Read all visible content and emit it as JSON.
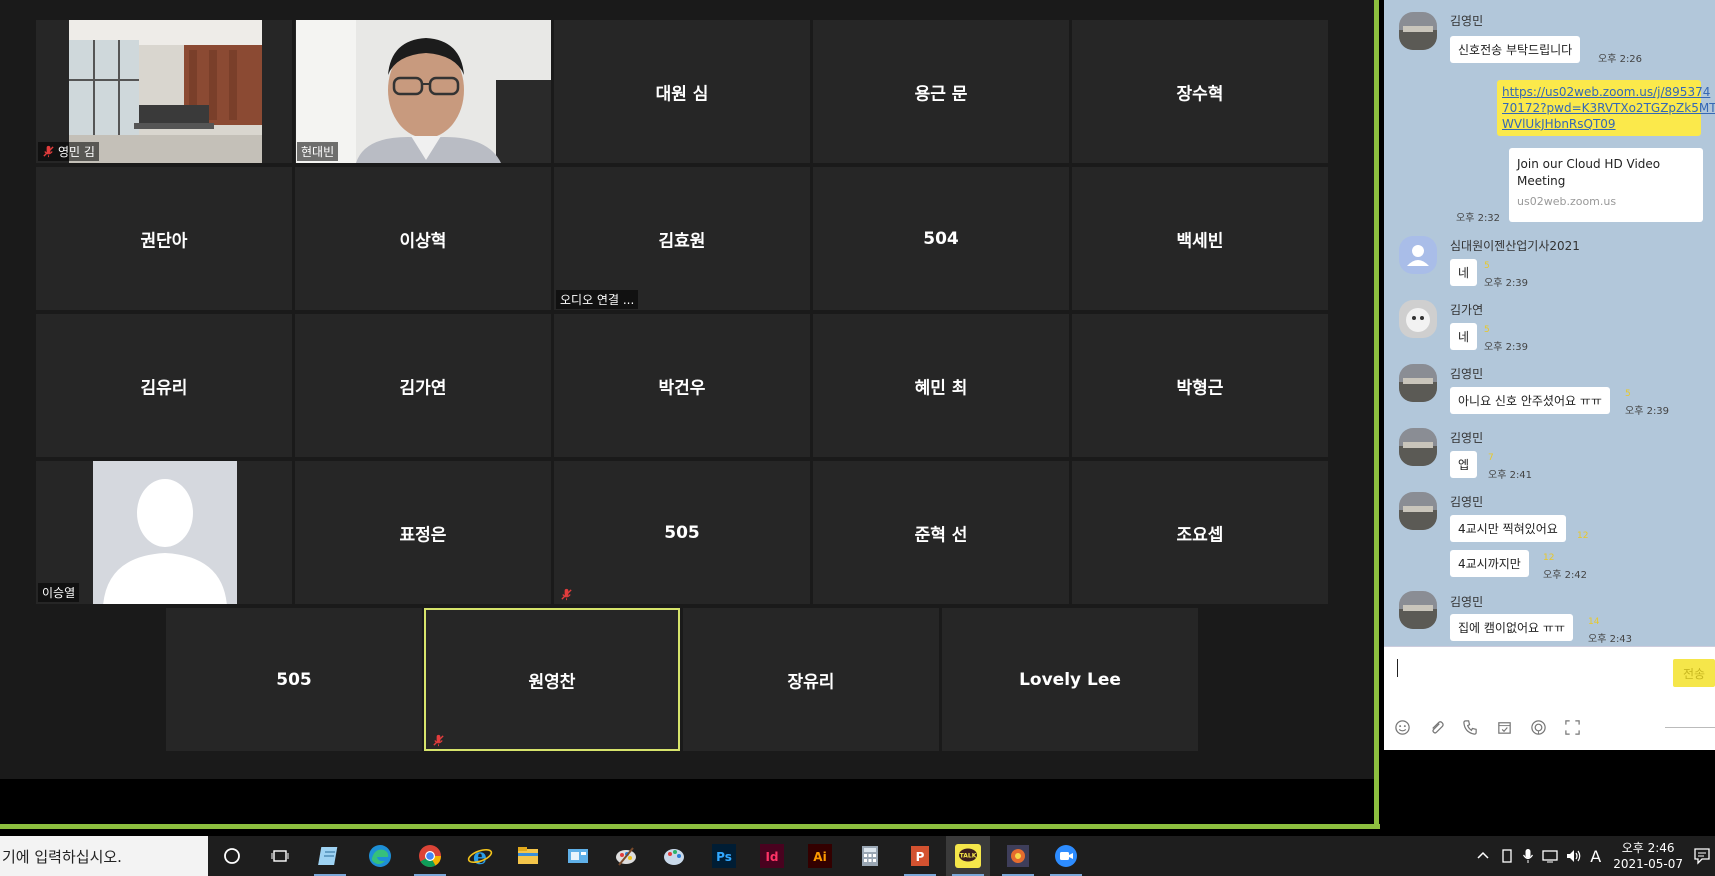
{
  "zoom": {
    "row1": [
      {
        "type": "video-office",
        "label": "영민 김",
        "muted": true
      },
      {
        "type": "video-person",
        "label": "현대빈",
        "muted": false
      },
      {
        "name": "대원 심"
      },
      {
        "name": "용근 문"
      },
      {
        "name": "장수혁"
      }
    ],
    "row2": [
      {
        "name": "권단아"
      },
      {
        "name": "이상혁"
      },
      {
        "name": "김효원",
        "label": "오디오 연결 ..."
      },
      {
        "name": "504"
      },
      {
        "name": "백세빈"
      }
    ],
    "row3": [
      {
        "name": "김유리"
      },
      {
        "name": "김가연"
      },
      {
        "name": "박건우"
      },
      {
        "name": "혜민 최"
      },
      {
        "name": "박형근"
      }
    ],
    "row4": [
      {
        "type": "avatar",
        "label": "이승열"
      },
      {
        "name": "표정은"
      },
      {
        "name": "505",
        "muted": true
      },
      {
        "name": "준혁 선"
      },
      {
        "name": "조요셉"
      }
    ],
    "row5": [
      {
        "name": "505"
      },
      {
        "name": "원영찬",
        "muted": true,
        "active": true
      },
      {
        "name": "장유리"
      },
      {
        "name": "Lovely Lee"
      }
    ]
  },
  "chat": {
    "messages": [
      {
        "sender": "김영민",
        "text": "신호전송 부탁드립니다",
        "time": "오후 2:26"
      },
      {
        "mine": true,
        "link_lines": [
          "https://us02web.zoom.us/j/895374",
          "70172?pwd=K3RVTXo2TGZpZk5MT",
          "WVlUkJHbnRsQT09"
        ]
      },
      {
        "mine": true,
        "card_title_lines": [
          "Join our Cloud HD Video",
          "Meeting"
        ],
        "card_domain": "us02web.zoom.us",
        "time": "오후 2:32"
      },
      {
        "sender": "심대원이젠산업기사2021",
        "text": "네",
        "time": "오후 2:39",
        "unread": "5"
      },
      {
        "sender": "김가연",
        "text": "네",
        "time": "오후 2:39",
        "unread": "5"
      },
      {
        "sender": "김영민",
        "text": "아니요 신호 안주셨어요 ㅠㅠ",
        "time": "오후 2:39",
        "unread": "5"
      },
      {
        "sender": "김영민",
        "text": "엡",
        "time": "오후 2:41",
        "unread": "7"
      },
      {
        "sender": "김영민",
        "text": "4교시만 찍혀있어요",
        "unread": "12"
      },
      {
        "text": "4교시까지만",
        "time": "오후 2:42",
        "unread": "12"
      },
      {
        "sender": "김영민",
        "text": "집에 캠이없어요 ㅠㅠ",
        "time": "오후 2:43",
        "unread": "14"
      }
    ],
    "send_label": "전송"
  },
  "taskbar": {
    "search_text": "기에 입력하십시오.",
    "clock_time": "오후 2:46",
    "clock_date": "2021-05-07",
    "ime": "A"
  },
  "colors": {
    "zoom_green": "#8dbf3f",
    "active_border": "#d6e36b",
    "kakao_yellow": "#f5e64a",
    "chat_bg": "#b2c7da"
  }
}
